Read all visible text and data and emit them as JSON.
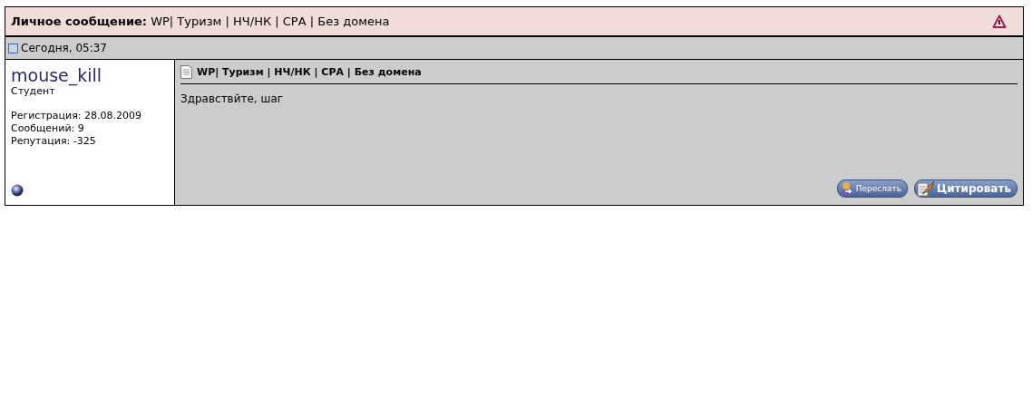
{
  "header": {
    "title": "**Личное сообщение:** WP| Туризм | НЧ/НК | СРА | Без домена"
  },
  "date": "Сегодня, 05:37",
  "author": {
    "name": "mouse_kill",
    "rank": "Студент",
    "stats": [
      "Регистрация: 28.08.2009",
      "Сообщений: 9",
      "Репутация: -325"
    ]
  },
  "post": {
    "subject": "WP| Туризм | НЧ/НК | СРА | Без домена",
    "body": "Здравствйте, шаг"
  },
  "buttons": [
    {
      "kind": "forward",
      "label": "Переслать"
    },
    {
      "kind": "quote",
      "label": "Цитировать"
    }
  ]
}
